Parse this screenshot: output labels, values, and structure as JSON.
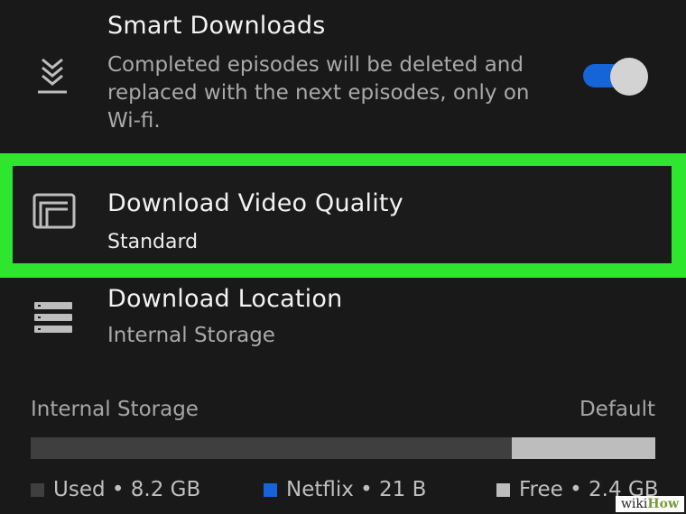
{
  "smart_downloads": {
    "title": "Smart Downloads",
    "description": "Completed episodes will be deleted and replaced with the next episodes, only on Wi-fi.",
    "icon": "smart-downloads-icon",
    "toggle_on": true,
    "toggle_color": "#1565d8"
  },
  "video_quality": {
    "title": "Download Video Quality",
    "value": "Standard",
    "icon": "video-quality-icon",
    "highlight_color": "#2ee62e"
  },
  "location": {
    "title": "Download Location",
    "value": "Internal Storage",
    "icon": "storage-list-icon"
  },
  "storage": {
    "label": "Internal Storage",
    "default_label": "Default",
    "used_fraction": 0.77,
    "netflix_fraction": 0.0,
    "free_fraction": 0.23,
    "legend": {
      "used": "Used • 8.2 GB",
      "netflix": "Netflix • 21 B",
      "free": "Free • 2.4 GB"
    },
    "colors": {
      "used": "#3f3f3f",
      "netflix": "#1565d8",
      "free": "#bdbdbd"
    }
  },
  "watermark": {
    "prefix": "wiki",
    "suffix": "How"
  }
}
